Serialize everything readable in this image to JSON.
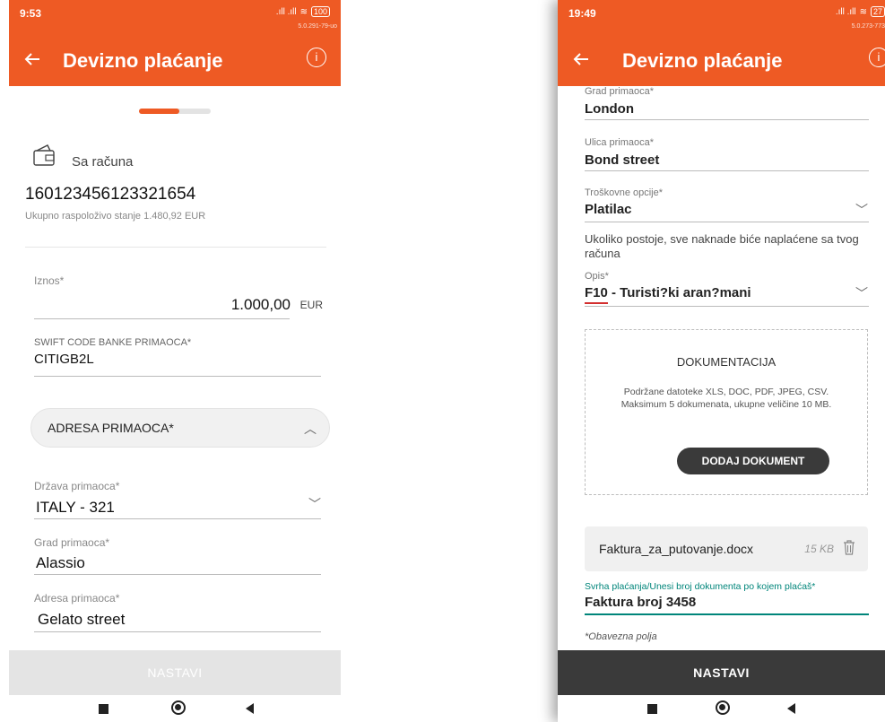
{
  "left": {
    "status": {
      "time": "9:53",
      "signal": ".ıll .ıll",
      "battery": "100",
      "version": "5.0.291-79-uo"
    },
    "appbar": {
      "title": "Devizno plaćanje",
      "info": "i"
    },
    "account": {
      "label": "Sa računa",
      "number": "160123456123321654",
      "balance": "Ukupno raspoloživo stanje 1.480,92 EUR"
    },
    "amount": {
      "label": "Iznos*",
      "value": "1.000,00",
      "currency": "EUR"
    },
    "swift": {
      "label": "SWIFT CODE BANKE PRIMAOCA*",
      "value": "CITIGB2L"
    },
    "address_section": {
      "label": "ADRESA PRIMAOCA*"
    },
    "country": {
      "label": "Država primaoca*",
      "value": "ITALY - 321"
    },
    "city": {
      "label": "Grad primaoca*",
      "value": "Alassio"
    },
    "address": {
      "label": "Adresa primaoca*",
      "value": "Gelato street"
    },
    "next_button": "NASTAVI",
    "progress_fraction": 0.56
  },
  "right": {
    "status": {
      "time": "19:49",
      "signal": ".ıll .ıll",
      "battery": "27",
      "version": "5.0.273-773"
    },
    "appbar": {
      "title": "Devizno plaćanje",
      "info": "i"
    },
    "city": {
      "label": "Grad primaoca*",
      "value": "London"
    },
    "street": {
      "label": "Ulica primaoca*",
      "value": "Bond street"
    },
    "cost": {
      "label": "Troškovne opcije*",
      "value": "Platilac"
    },
    "cost_note": "Ukoliko postoje, sve naknade biće naplaćene sa tvog računa",
    "description": {
      "label": "Opis*",
      "value": "F10 - Turisti?ki aran?mani"
    },
    "documentation": {
      "title": "DOKUMENTACIJA",
      "info": "Podržane datoteke XLS, DOC, PDF, JPEG, CSV. Maksimum 5 dokumenata, ukupne veličine 10 MB.",
      "add_button": "DODAJ DOKUMENT"
    },
    "file": {
      "name": "Faktura_za_putovanje.docx",
      "size": "15 KB"
    },
    "purpose": {
      "label": "Svrha plaćanja/Unesi broj dokumenta po kojem plaćaš*",
      "value": "Faktura broj 3458"
    },
    "required_note": "*Obavezna polja",
    "next_button": "NASTAVI"
  },
  "colors": {
    "brand": "#ee5a24",
    "accent_teal": "#00857a",
    "dark_button": "#3a3a3a"
  }
}
